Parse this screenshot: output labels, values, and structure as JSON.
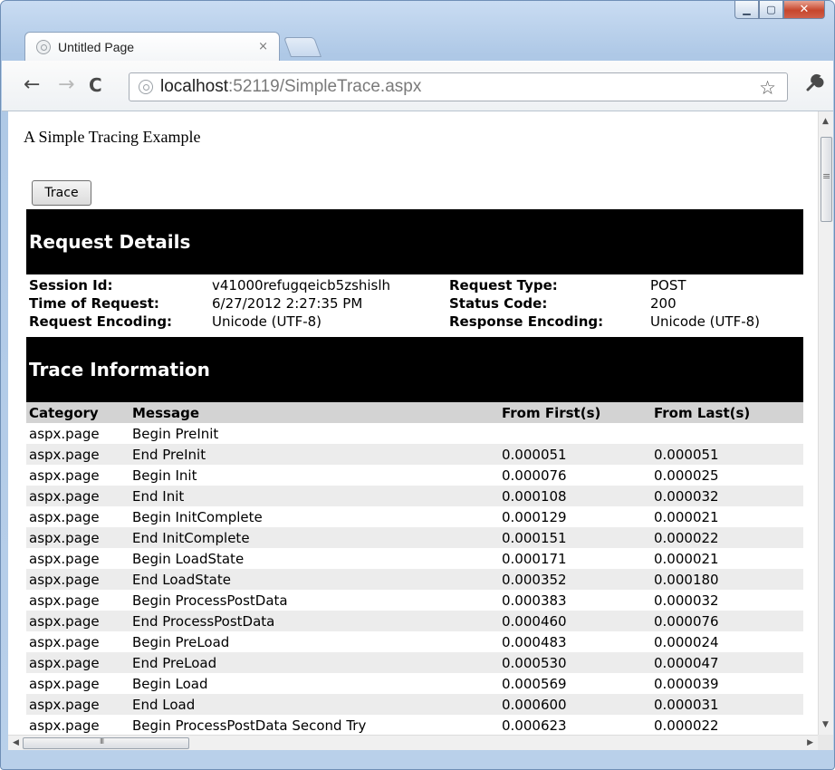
{
  "window": {
    "controls": {
      "minimize": "▁",
      "maximize": "▢",
      "close": "✕"
    }
  },
  "tab": {
    "title": "Untitled Page",
    "close": "×",
    "icon": "page-globe-icon"
  },
  "toolbar": {
    "back": "←",
    "forward": "→",
    "reload": "C",
    "url_host": "localhost",
    "url_rest": ":52119/SimpleTrace.aspx",
    "star": "☆",
    "wrench": "🔧"
  },
  "page": {
    "heading": "A Simple Tracing Example",
    "trace_button": "Trace",
    "request_details": {
      "title": "Request Details",
      "rows": [
        {
          "label1": "Session Id:",
          "value1": "v41000refugqeicb5zshislh",
          "label2": "Request Type:",
          "value2": "POST"
        },
        {
          "label1": "Time of Request:",
          "value1": "6/27/2012 2:27:35 PM",
          "label2": "Status Code:",
          "value2": "200"
        },
        {
          "label1": "Request Encoding:",
          "value1": "Unicode (UTF-8)",
          "label2": "Response Encoding:",
          "value2": "Unicode (UTF-8)"
        }
      ]
    },
    "trace_information": {
      "title": "Trace Information",
      "headers": [
        "Category",
        "Message",
        "From First(s)",
        "From Last(s)"
      ],
      "rows": [
        [
          "aspx.page",
          "Begin PreInit",
          "",
          ""
        ],
        [
          "aspx.page",
          "End PreInit",
          "0.000051",
          "0.000051"
        ],
        [
          "aspx.page",
          "Begin Init",
          "0.000076",
          "0.000025"
        ],
        [
          "aspx.page",
          "End Init",
          "0.000108",
          "0.000032"
        ],
        [
          "aspx.page",
          "Begin InitComplete",
          "0.000129",
          "0.000021"
        ],
        [
          "aspx.page",
          "End InitComplete",
          "0.000151",
          "0.000022"
        ],
        [
          "aspx.page",
          "Begin LoadState",
          "0.000171",
          "0.000021"
        ],
        [
          "aspx.page",
          "End LoadState",
          "0.000352",
          "0.000180"
        ],
        [
          "aspx.page",
          "Begin ProcessPostData",
          "0.000383",
          "0.000032"
        ],
        [
          "aspx.page",
          "End ProcessPostData",
          "0.000460",
          "0.000076"
        ],
        [
          "aspx.page",
          "Begin PreLoad",
          "0.000483",
          "0.000024"
        ],
        [
          "aspx.page",
          "End PreLoad",
          "0.000530",
          "0.000047"
        ],
        [
          "aspx.page",
          "Begin Load",
          "0.000569",
          "0.000039"
        ],
        [
          "aspx.page",
          "End Load",
          "0.000600",
          "0.000031"
        ],
        [
          "aspx.page",
          "Begin ProcessPostData Second Try",
          "0.000623",
          "0.000022"
        ]
      ]
    }
  },
  "colors": {
    "banner": "#000000",
    "header_row": "#d3d3d3",
    "alt_row": "#ececec"
  }
}
